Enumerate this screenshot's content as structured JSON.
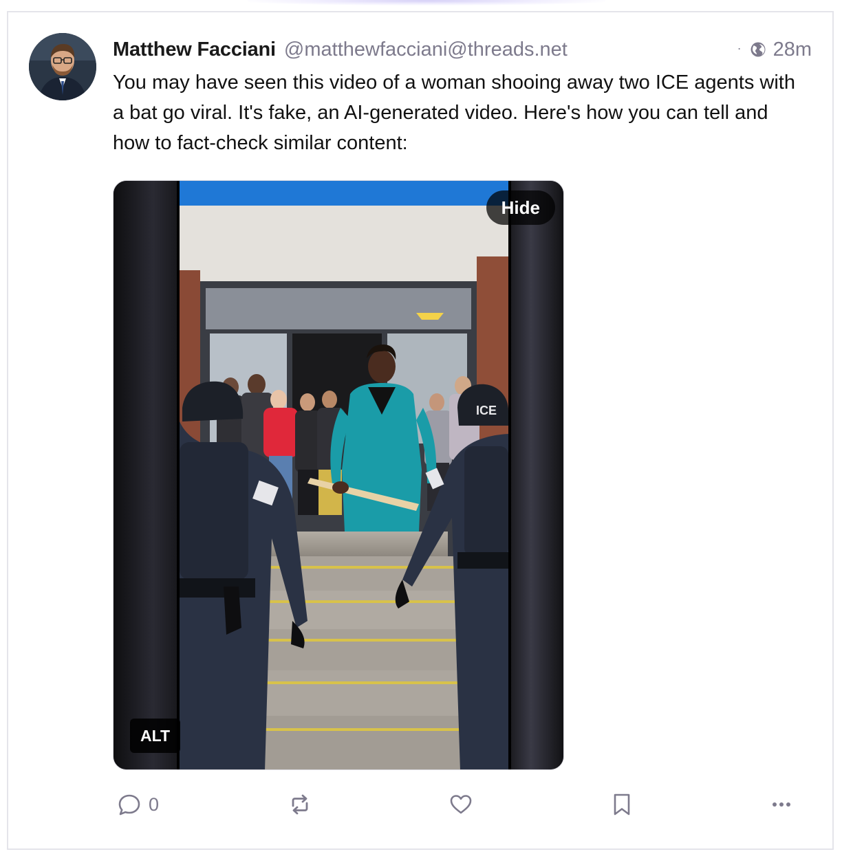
{
  "post": {
    "author": {
      "display_name": "Matthew Facciani",
      "handle": "@matthewfacciani@threads.net",
      "avatar_icon": "person-avatar"
    },
    "meta": {
      "separator": "·",
      "visibility_icon": "globe-icon",
      "age": "28m"
    },
    "text": "You may have seen this video of a woman shooing away two ICE agents with a bat go viral. It's fake, an AI-generated video. Here's how you can tell and how to fact-check similar content:",
    "media": {
      "hide_label": "Hide",
      "alt_label": "ALT",
      "vest_label": "ICE"
    },
    "actions": {
      "reply_count": "0",
      "reply_icon": "speech-bubble-icon",
      "boost_icon": "repost-icon",
      "favourite_icon": "heart-icon",
      "bookmark_icon": "bookmark-icon",
      "more_icon": "ellipsis-icon"
    }
  },
  "colors": {
    "muted": "#7d7a8c",
    "border": "#e4e4ea",
    "text": "#111111"
  }
}
